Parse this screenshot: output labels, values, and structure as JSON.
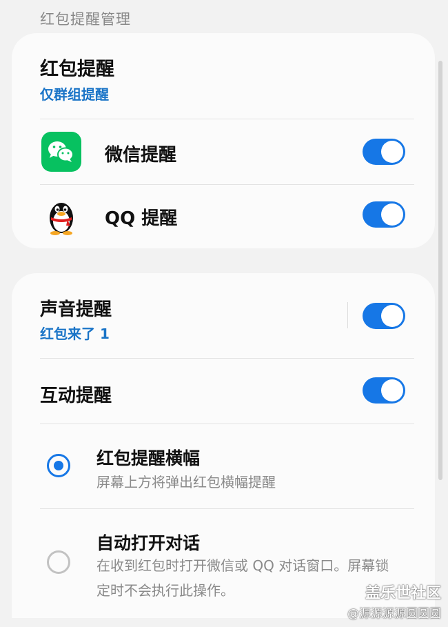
{
  "header": {
    "section_title": "红包提醒管理"
  },
  "card1": {
    "title": "红包提醒",
    "subtitle": "仅群组提醒",
    "wechat": {
      "label": "微信提醒",
      "enabled": true,
      "icon": "wechat-icon"
    },
    "qq": {
      "label": "QQ 提醒",
      "enabled": true,
      "icon": "qq-penguin-icon"
    }
  },
  "card2": {
    "sound": {
      "title": "声音提醒",
      "subtitle": "红包来了 1",
      "enabled": true
    },
    "interaction": {
      "title": "互动提醒",
      "enabled": true
    },
    "options": [
      {
        "title": "红包提醒横幅",
        "desc": "屏幕上方将弹出红包横幅提醒",
        "selected": true
      },
      {
        "title": "自动打开对话",
        "desc_line1": "在收到红包时打开微信或 QQ 对话窗口。屏幕锁",
        "desc_line2": "定时不会执行此操作。",
        "selected": false
      }
    ]
  },
  "watermark": {
    "brand": "盖乐世社区",
    "user": "@源源源源圆圆圆"
  },
  "colors": {
    "accent": "#1677e6",
    "subtitle": "#1a74c7",
    "wechat_green": "#07c160"
  }
}
